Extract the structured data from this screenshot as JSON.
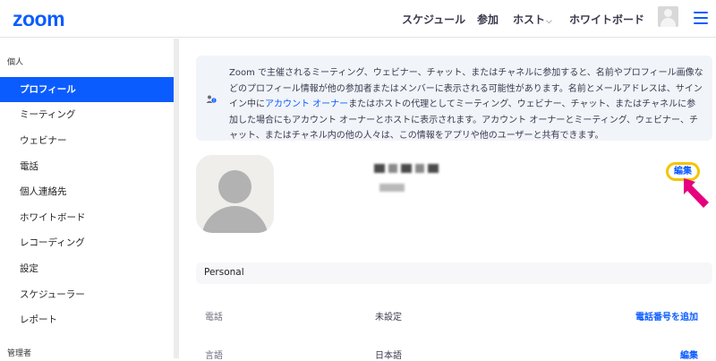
{
  "header": {
    "logo": "zoom",
    "nav": {
      "schedule": "スケジュール",
      "join": "参加",
      "host": "ホスト",
      "whiteboard": "ホワイトボード"
    }
  },
  "sidebar": {
    "section_personal": "個人",
    "items": [
      {
        "label": "プロフィール",
        "active": true
      },
      {
        "label": "ミーティング"
      },
      {
        "label": "ウェビナー"
      },
      {
        "label": "電話"
      },
      {
        "label": "個人連絡先"
      },
      {
        "label": "ホワイトボード"
      },
      {
        "label": "レコーディング"
      },
      {
        "label": "設定"
      },
      {
        "label": "スケジューラー"
      },
      {
        "label": "レポート"
      }
    ],
    "section_admin": "管理者"
  },
  "notice": {
    "text_before_link": "Zoom で主催されるミーティング、ウェビナー、チャット、またはチャネルに参加すると、名前やプロフィール画像などのプロフィール情報が他の参加者またはメンバーに表示される可能性があります。名前とメールアドレスは、サイン イン中に",
    "link": "アカウント オーナー",
    "text_after_link": "またはホストの代理としてミーティング、ウェビナー、チャット、またはチャネルに参加した場合にもアカウント オーナーとホストに表示されます。アカウント オーナーとミーティング、ウェビナー、チャット、またはチャネル内の他の人々は、この情報をアプリや他のユーザーと共有できます。"
  },
  "profile": {
    "edit_label": "編集"
  },
  "personal": {
    "section_title": "Personal",
    "rows": [
      {
        "label": "電話",
        "value": "未設定",
        "action": "電話番号を追加"
      },
      {
        "label": "言語",
        "value": "日本語",
        "action": "編集"
      }
    ]
  },
  "colors": {
    "accent": "#0b5cff",
    "highlight_ring": "#f2c500",
    "pointer": "#e6007e"
  }
}
